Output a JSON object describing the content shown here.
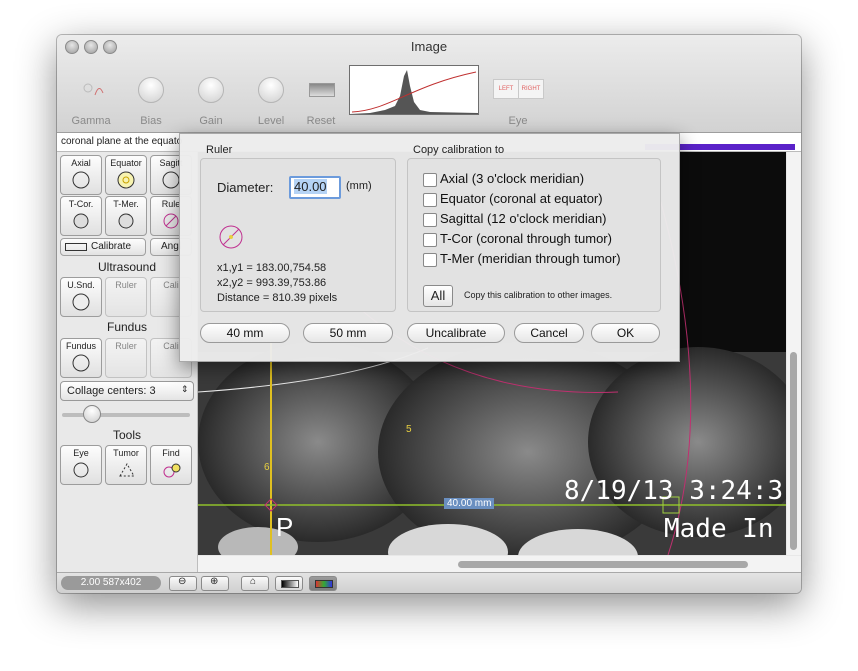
{
  "window": {
    "title": "Image"
  },
  "toolbar": {
    "gamma": "Gamma",
    "bias": "Bias",
    "gain": "Gain",
    "level": "Level",
    "reset": "Reset",
    "eye": "Eye",
    "eye_left": "LEFT",
    "eye_right": "RIGHT"
  },
  "infobar": {
    "plane_text": "coronal plane at the equato"
  },
  "left_panel": {
    "buttons_row1": [
      "Axial",
      "Equator",
      "Sagitt"
    ],
    "buttons_row2": [
      "T-Cor.",
      "T-Mer.",
      "Rule"
    ],
    "calibrate": "Calibrate",
    "angle": "Angl",
    "ultrasound_title": "Ultrasound",
    "ultrasound_buttons": [
      "U.Snd.",
      "Ruler",
      "Cali"
    ],
    "fundus_title": "Fundus",
    "fundus_buttons": [
      "Fundus",
      "Ruler",
      "Cali"
    ],
    "collage": "Collage centers: 3",
    "tools_title": "Tools",
    "tools_buttons": [
      "Eye",
      "Tumor",
      "Find"
    ]
  },
  "image": {
    "timestamp": "8/19/13 3:24:3",
    "made_in": "Made In C",
    "letter_p": "P",
    "measure_label": "40.00 mm",
    "marker_5": "5",
    "marker_6": "6"
  },
  "bottom_bar": {
    "zoom_text": "2.00 587x402"
  },
  "dialog": {
    "ruler_title": "Ruler",
    "diameter_label": "Diameter:",
    "diameter_value": "40.00",
    "unit": "(mm)",
    "coords1": "x1,y1 = 183.00,754.58",
    "coords2": "x2,y2 = 993.39,753.86",
    "distance": "Distance = 810.39 pixels",
    "copy_title": "Copy calibration to",
    "checkboxes": [
      "Axial (3 o'clock meridian)",
      "Equator (coronal at equator)",
      "Sagittal (12 o'clock meridian)",
      "T-Cor (coronal through tumor)",
      "T-Mer (meridian through tumor)"
    ],
    "all_button": "All",
    "all_hint": "Copy this calibration to other images.",
    "btn_40": "40 mm",
    "btn_50": "50 mm",
    "btn_uncal": "Uncalibrate",
    "btn_cancel": "Cancel",
    "btn_ok": "OK"
  }
}
